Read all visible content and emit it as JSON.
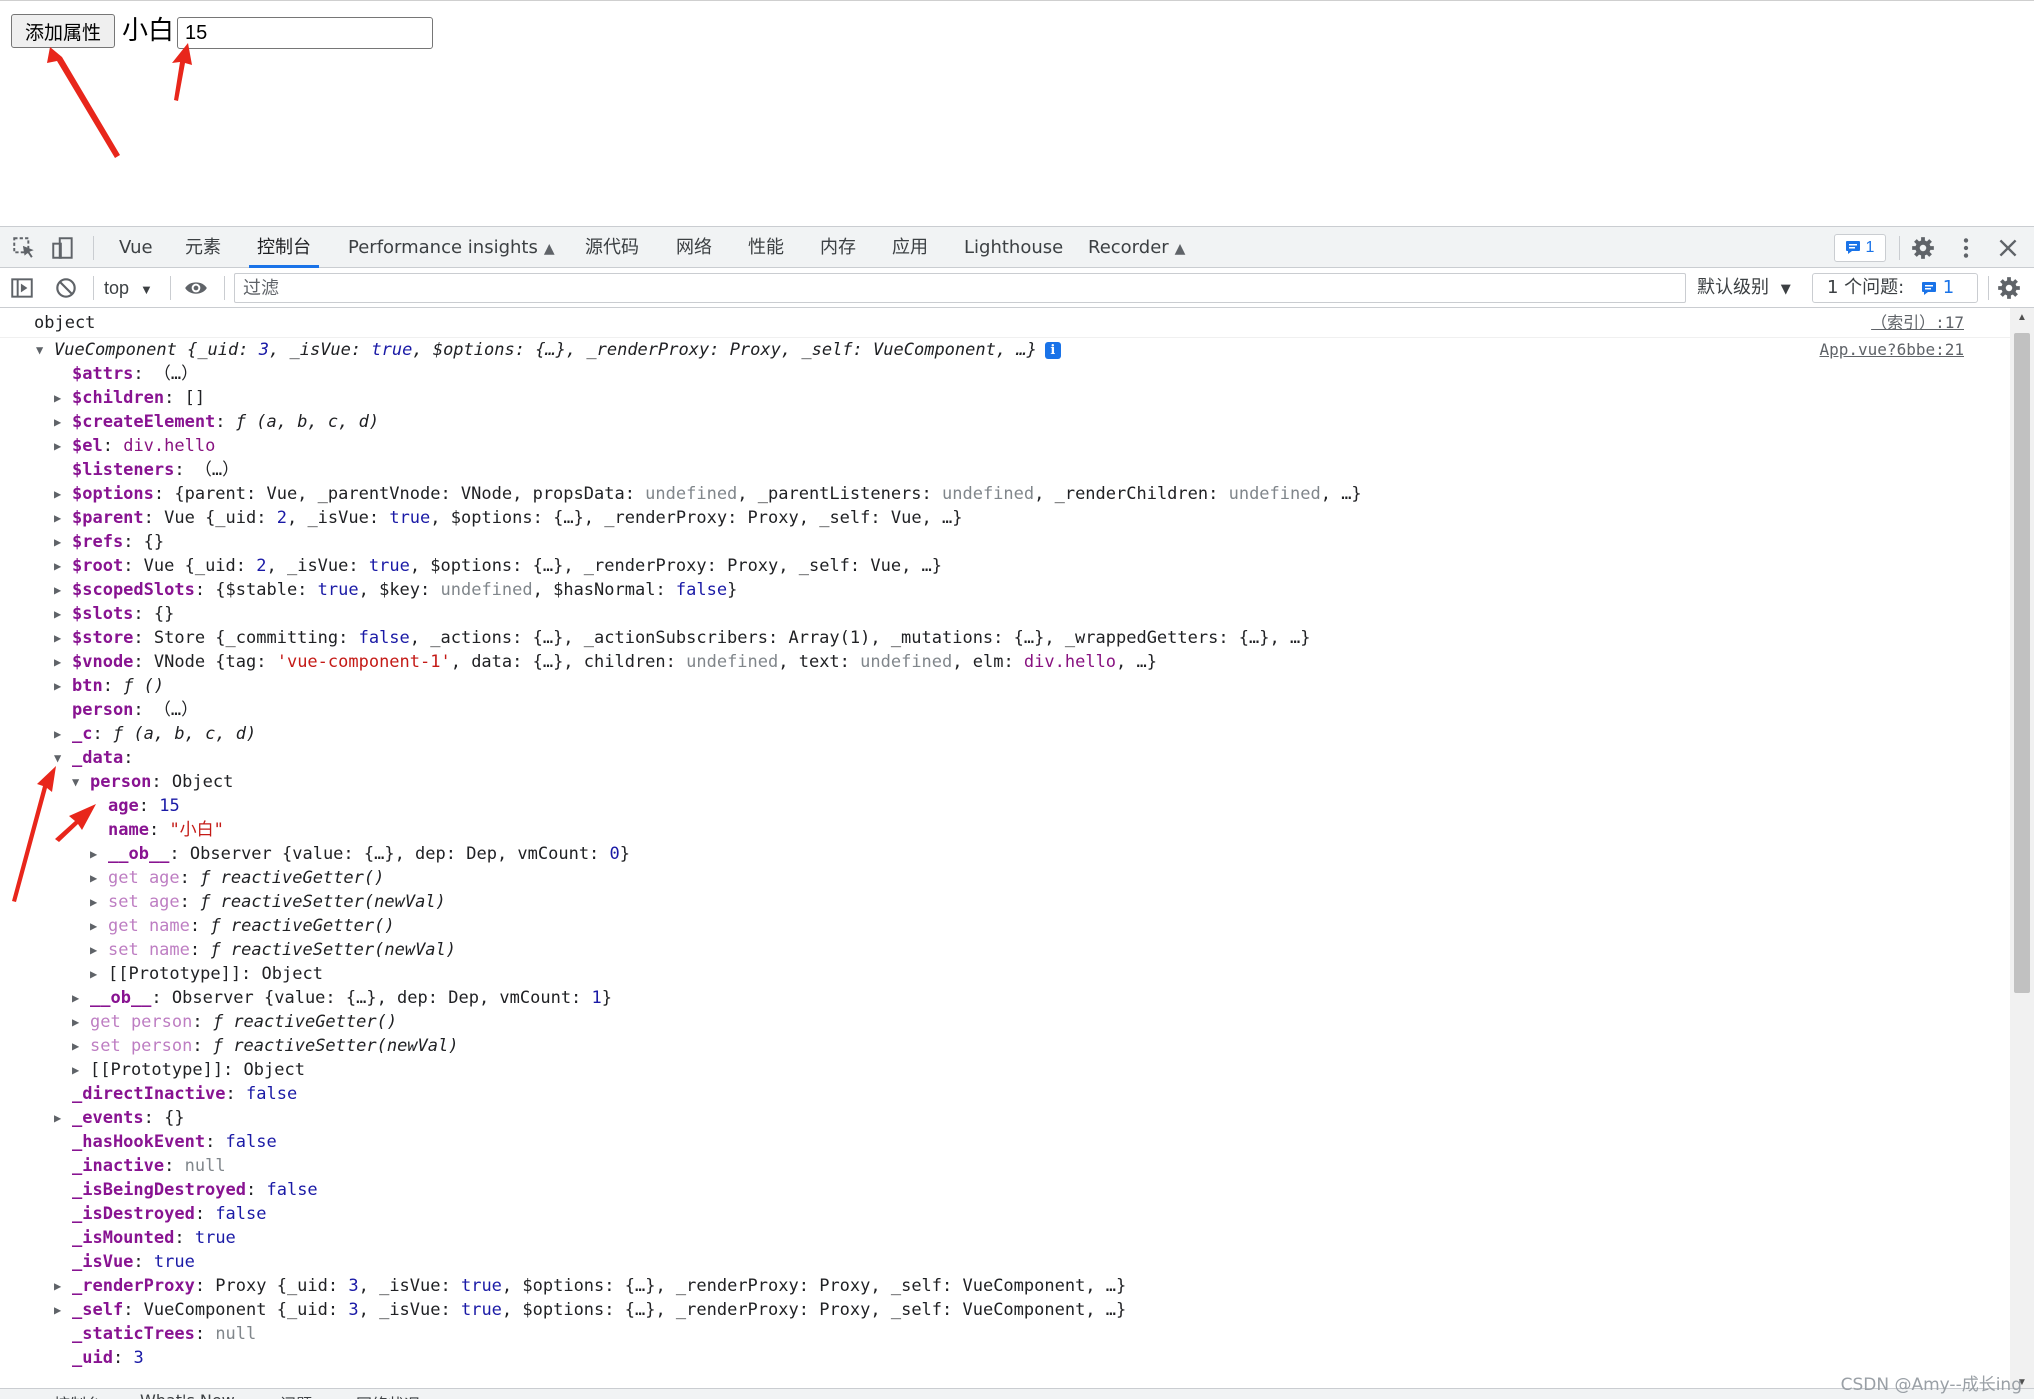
{
  "page": {
    "add_button_label": "添加属性",
    "name_text": "小白",
    "age_input_value": "15"
  },
  "devtools": {
    "tabs": [
      {
        "label": "Vue"
      },
      {
        "label": "元素"
      },
      {
        "label": "控制台"
      },
      {
        "label": "Performance insights"
      },
      {
        "label": "源代码"
      },
      {
        "label": "网络"
      },
      {
        "label": "性能"
      },
      {
        "label": "内存"
      },
      {
        "label": "应用"
      },
      {
        "label": "Lighthouse"
      },
      {
        "label": "Recorder"
      }
    ],
    "active_tab": "控制台",
    "issues_count": "1"
  },
  "toolbar": {
    "context": "top",
    "filter_placeholder": "过滤",
    "levels": "默认级别",
    "issues_label": "1 个问题:",
    "issues_badge": "1"
  },
  "console": {
    "log_text": "object",
    "log_source": "（索引）:17",
    "object_source": "App.vue?6bbe:21",
    "lines": [
      {
        "indent": 0,
        "tri": "down",
        "parts": [
          [
            "fn",
            "VueComponent "
          ],
          [
            "v",
            "{"
          ],
          [
            "pk",
            "_uid"
          ],
          [
            "v",
            ": "
          ],
          [
            "num",
            "3"
          ],
          [
            "v",
            ", "
          ],
          [
            "pk",
            "_isVue"
          ],
          [
            "v",
            ": "
          ],
          [
            "bool",
            "true"
          ],
          [
            "v",
            ", "
          ],
          [
            "pk",
            "$options"
          ],
          [
            "v",
            ": {…}, "
          ],
          [
            "pk",
            "_renderProxy"
          ],
          [
            "v",
            ": "
          ],
          [
            "fn",
            "Proxy"
          ],
          [
            "v",
            ", "
          ],
          [
            "pk",
            "_self"
          ],
          [
            "v",
            ": "
          ],
          [
            "fn",
            "VueComponent"
          ],
          [
            "v",
            ", …}"
          ]
        ],
        "info": true
      },
      {
        "indent": 1,
        "tri": "",
        "parts": [
          [
            "key",
            "$attrs"
          ],
          [
            "v",
            ": （…）"
          ]
        ]
      },
      {
        "indent": 1,
        "tri": "right",
        "parts": [
          [
            "key",
            "$children"
          ],
          [
            "v",
            ": []"
          ]
        ]
      },
      {
        "indent": 1,
        "tri": "right",
        "parts": [
          [
            "key",
            "$createElement"
          ],
          [
            "v",
            ": "
          ],
          [
            "fn",
            "ƒ (a, b, c, d)"
          ]
        ]
      },
      {
        "indent": 1,
        "tri": "right",
        "parts": [
          [
            "key",
            "$el"
          ],
          [
            "v",
            ": "
          ],
          [
            "el",
            "div.hello"
          ]
        ]
      },
      {
        "indent": 1,
        "tri": "",
        "parts": [
          [
            "key",
            "$listeners"
          ],
          [
            "v",
            ": （…）"
          ]
        ]
      },
      {
        "indent": 1,
        "tri": "right",
        "parts": [
          [
            "key",
            "$options"
          ],
          [
            "v",
            ": {parent: Vue, _parentVnode: VNode, propsData: "
          ],
          [
            "undef",
            "undefined"
          ],
          [
            "v",
            ", _parentListeners: "
          ],
          [
            "undef",
            "undefined"
          ],
          [
            "v",
            ", _renderChildren: "
          ],
          [
            "undef",
            "undefined"
          ],
          [
            "v",
            ", …}"
          ]
        ]
      },
      {
        "indent": 1,
        "tri": "right",
        "parts": [
          [
            "key",
            "$parent"
          ],
          [
            "v",
            ": Vue {_uid: "
          ],
          [
            "num",
            "2"
          ],
          [
            "v",
            ", _isVue: "
          ],
          [
            "bool",
            "true"
          ],
          [
            "v",
            ", $options: {…}, _renderProxy: Proxy, _self: Vue, …}"
          ]
        ]
      },
      {
        "indent": 1,
        "tri": "right",
        "parts": [
          [
            "key",
            "$refs"
          ],
          [
            "v",
            ": {}"
          ]
        ]
      },
      {
        "indent": 1,
        "tri": "right",
        "parts": [
          [
            "key",
            "$root"
          ],
          [
            "v",
            ": Vue {_uid: "
          ],
          [
            "num",
            "2"
          ],
          [
            "v",
            ", _isVue: "
          ],
          [
            "bool",
            "true"
          ],
          [
            "v",
            ", $options: {…}, _renderProxy: Proxy, _self: Vue, …}"
          ]
        ]
      },
      {
        "indent": 1,
        "tri": "right",
        "parts": [
          [
            "key",
            "$scopedSlots"
          ],
          [
            "v",
            ": {$stable: "
          ],
          [
            "bool",
            "true"
          ],
          [
            "v",
            ", $key: "
          ],
          [
            "undef",
            "undefined"
          ],
          [
            "v",
            ", $hasNormal: "
          ],
          [
            "bool",
            "false"
          ],
          [
            "v",
            "}"
          ]
        ]
      },
      {
        "indent": 1,
        "tri": "right",
        "parts": [
          [
            "key",
            "$slots"
          ],
          [
            "v",
            ": {}"
          ]
        ]
      },
      {
        "indent": 1,
        "tri": "right",
        "parts": [
          [
            "key",
            "$store"
          ],
          [
            "v",
            ": Store {_committing: "
          ],
          [
            "bool",
            "false"
          ],
          [
            "v",
            ", _actions: {…}, _actionSubscribers: Array(1), _mutations: {…}, _wrappedGetters: {…}, …}"
          ]
        ]
      },
      {
        "indent": 1,
        "tri": "right",
        "parts": [
          [
            "key",
            "$vnode"
          ],
          [
            "v",
            ": VNode {tag: "
          ],
          [
            "str",
            "'vue-component-1'"
          ],
          [
            "v",
            ", data: {…}, children: "
          ],
          [
            "undef",
            "undefined"
          ],
          [
            "v",
            ", text: "
          ],
          [
            "undef",
            "undefined"
          ],
          [
            "v",
            ", elm: "
          ],
          [
            "el",
            "div.hello"
          ],
          [
            "v",
            ", …}"
          ]
        ]
      },
      {
        "indent": 1,
        "tri": "right",
        "parts": [
          [
            "key",
            "btn"
          ],
          [
            "v",
            ": "
          ],
          [
            "fn",
            "ƒ ()"
          ]
        ]
      },
      {
        "indent": 1,
        "tri": "",
        "parts": [
          [
            "key",
            "person"
          ],
          [
            "v",
            ": （…）"
          ]
        ]
      },
      {
        "indent": 1,
        "tri": "right",
        "parts": [
          [
            "key",
            "_c"
          ],
          [
            "v",
            ": "
          ],
          [
            "fn",
            "ƒ (a, b, c, d)"
          ]
        ]
      },
      {
        "indent": 1,
        "tri": "down",
        "parts": [
          [
            "key",
            "_data"
          ],
          [
            "v",
            ":"
          ]
        ]
      },
      {
        "indent": 2,
        "tri": "down",
        "parts": [
          [
            "key",
            "person"
          ],
          [
            "v",
            ": Object"
          ]
        ]
      },
      {
        "indent": 3,
        "tri": "",
        "parts": [
          [
            "key",
            "age"
          ],
          [
            "v",
            ": "
          ],
          [
            "num",
            "15"
          ]
        ]
      },
      {
        "indent": 3,
        "tri": "",
        "parts": [
          [
            "key",
            "name"
          ],
          [
            "v",
            ": "
          ],
          [
            "str",
            "\"小白\""
          ]
        ]
      },
      {
        "indent": 3,
        "tri": "right",
        "parts": [
          [
            "key",
            "__ob__"
          ],
          [
            "v",
            ": Observer {value: {…}, dep: Dep, vmCount: "
          ],
          [
            "num",
            "0"
          ],
          [
            "v",
            "}"
          ]
        ]
      },
      {
        "indent": 3,
        "tri": "right",
        "parts": [
          [
            "gs",
            "get age"
          ],
          [
            "v",
            ": "
          ],
          [
            "fn",
            "ƒ reactiveGetter()"
          ]
        ]
      },
      {
        "indent": 3,
        "tri": "right",
        "parts": [
          [
            "gs",
            "set age"
          ],
          [
            "v",
            ": "
          ],
          [
            "fn",
            "ƒ reactiveSetter(newVal)"
          ]
        ]
      },
      {
        "indent": 3,
        "tri": "right",
        "parts": [
          [
            "gs",
            "get name"
          ],
          [
            "v",
            ": "
          ],
          [
            "fn",
            "ƒ reactiveGetter()"
          ]
        ]
      },
      {
        "indent": 3,
        "tri": "right",
        "parts": [
          [
            "gs",
            "set name"
          ],
          [
            "v",
            ": "
          ],
          [
            "fn",
            "ƒ reactiveSetter(newVal)"
          ]
        ]
      },
      {
        "indent": 3,
        "tri": "right",
        "parts": [
          [
            "v",
            "[[Prototype]]: Object"
          ]
        ]
      },
      {
        "indent": 2,
        "tri": "right",
        "parts": [
          [
            "key",
            "__ob__"
          ],
          [
            "v",
            ": Observer {value: {…}, dep: Dep, vmCount: "
          ],
          [
            "num",
            "1"
          ],
          [
            "v",
            "}"
          ]
        ]
      },
      {
        "indent": 2,
        "tri": "right",
        "parts": [
          [
            "gs",
            "get person"
          ],
          [
            "v",
            ": "
          ],
          [
            "fn",
            "ƒ reactiveGetter()"
          ]
        ]
      },
      {
        "indent": 2,
        "tri": "right",
        "parts": [
          [
            "gs",
            "set person"
          ],
          [
            "v",
            ": "
          ],
          [
            "fn",
            "ƒ reactiveSetter(newVal)"
          ]
        ]
      },
      {
        "indent": 2,
        "tri": "right",
        "parts": [
          [
            "v",
            "[[Prototype]]: Object"
          ]
        ]
      },
      {
        "indent": 1,
        "tri": "",
        "parts": [
          [
            "key",
            "_directInactive"
          ],
          [
            "v",
            ": "
          ],
          [
            "bool",
            "false"
          ]
        ]
      },
      {
        "indent": 1,
        "tri": "right",
        "parts": [
          [
            "key",
            "_events"
          ],
          [
            "v",
            ": {}"
          ]
        ]
      },
      {
        "indent": 1,
        "tri": "",
        "parts": [
          [
            "key",
            "_hasHookEvent"
          ],
          [
            "v",
            ": "
          ],
          [
            "bool",
            "false"
          ]
        ]
      },
      {
        "indent": 1,
        "tri": "",
        "parts": [
          [
            "key",
            "_inactive"
          ],
          [
            "v",
            ": "
          ],
          [
            "null",
            "null"
          ]
        ]
      },
      {
        "indent": 1,
        "tri": "",
        "parts": [
          [
            "key",
            "_isBeingDestroyed"
          ],
          [
            "v",
            ": "
          ],
          [
            "bool",
            "false"
          ]
        ]
      },
      {
        "indent": 1,
        "tri": "",
        "parts": [
          [
            "key",
            "_isDestroyed"
          ],
          [
            "v",
            ": "
          ],
          [
            "bool",
            "false"
          ]
        ]
      },
      {
        "indent": 1,
        "tri": "",
        "parts": [
          [
            "key",
            "_isMounted"
          ],
          [
            "v",
            ": "
          ],
          [
            "bool",
            "true"
          ]
        ]
      },
      {
        "indent": 1,
        "tri": "",
        "parts": [
          [
            "key",
            "_isVue"
          ],
          [
            "v",
            ": "
          ],
          [
            "bool",
            "true"
          ]
        ]
      },
      {
        "indent": 1,
        "tri": "right",
        "parts": [
          [
            "key",
            "_renderProxy"
          ],
          [
            "v",
            ": Proxy {_uid: "
          ],
          [
            "num",
            "3"
          ],
          [
            "v",
            ", _isVue: "
          ],
          [
            "bool",
            "true"
          ],
          [
            "v",
            ", $options: {…}, _renderProxy: Proxy, _self: VueComponent, …}"
          ]
        ]
      },
      {
        "indent": 1,
        "tri": "right",
        "parts": [
          [
            "key",
            "_self"
          ],
          [
            "v",
            ": VueComponent {_uid: "
          ],
          [
            "num",
            "3"
          ],
          [
            "v",
            ", _isVue: "
          ],
          [
            "bool",
            "true"
          ],
          [
            "v",
            ", $options: {…}, _renderProxy: Proxy, _self: VueComponent, …}"
          ]
        ]
      },
      {
        "indent": 1,
        "tri": "",
        "parts": [
          [
            "key",
            "_staticTrees"
          ],
          [
            "v",
            ": "
          ],
          [
            "null",
            "null"
          ]
        ]
      },
      {
        "indent": 1,
        "tri": "",
        "parts": [
          [
            "key",
            "_uid"
          ],
          [
            "v",
            ": "
          ],
          [
            "num",
            "3"
          ]
        ]
      }
    ]
  },
  "drawer": {
    "tabs": [
      "控制台",
      "What's New",
      "问题",
      "网络状况"
    ]
  },
  "watermark": "CSDN @Amy--成长ing",
  "colors": {
    "accent": "#1a73e8",
    "arrow_red": "#e8261b",
    "key_purple": "#881391",
    "value_blue": "#1a1aa6",
    "string_red": "#c41a16"
  }
}
